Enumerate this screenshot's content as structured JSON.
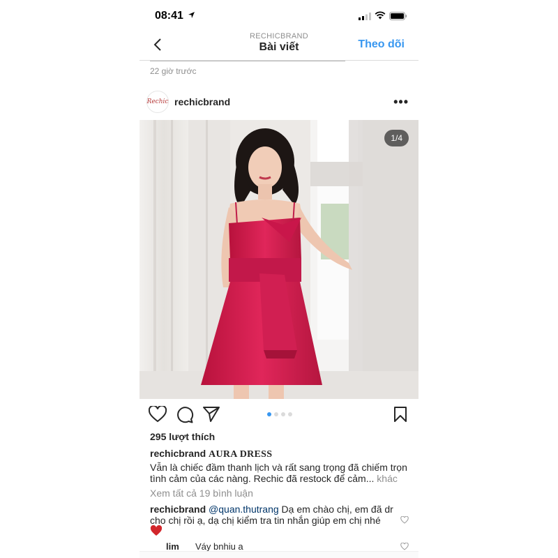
{
  "status": {
    "time": "08:41"
  },
  "nav": {
    "subtitle": "RECHICBRAND",
    "title": "Bài viết",
    "follow": "Theo dõi"
  },
  "previous_post": {
    "time_ago": "22 giờ trước"
  },
  "post": {
    "avatar_text": "Rechic",
    "username": "rechicbrand",
    "more": "•••",
    "image_counter": "1/4",
    "carousel": {
      "total": 4,
      "active": 1
    },
    "likes": "295 lượt thích",
    "caption_user": "rechicbrand",
    "caption_title": "AURA DRESS",
    "caption_line1": "Vẫn là chiếc đầm thanh lịch và rất sang trọng đã chiếm trọn",
    "caption_line2": "tình cảm của các nàng. Rechic đã restock để cảm...",
    "caption_more": "khác",
    "view_all_comments": "Xem tất cả 19 bình luận"
  },
  "comments": [
    {
      "user": "rechicbrand",
      "mention": "@quan.thutrang",
      "text": "Dạ em chào chị, em đã dr",
      "text_line2": "cho chị rồi ạ, dạ chị kiểm tra tin nhắn giúp em chị nhé",
      "emoji": "red-heart"
    },
    {
      "user": "lim",
      "text": "Váy bnhiu a"
    }
  ],
  "colors": {
    "accent": "#3897f0",
    "mention": "#003569",
    "muted": "#8e8e8e",
    "dress": "#d6204f"
  }
}
